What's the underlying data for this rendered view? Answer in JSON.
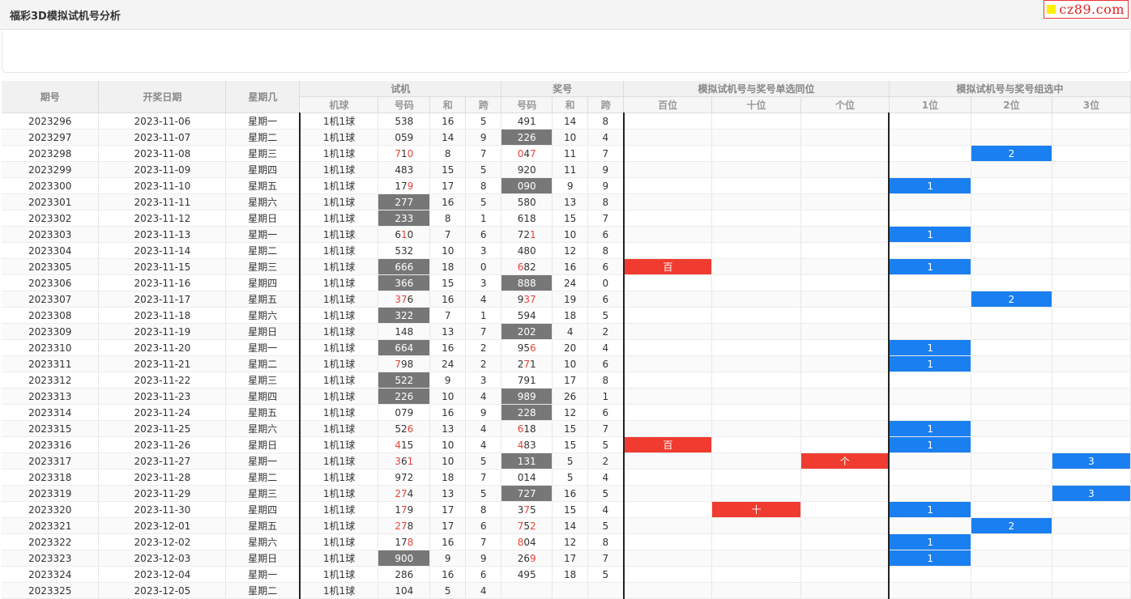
{
  "page": {
    "title": "福彩3D模拟试机号分析"
  },
  "logo": {
    "text": "cz89.com"
  },
  "table": {
    "header_row1": [
      "期号",
      "开奖日期",
      "星期几",
      "试机",
      "奖号",
      "模拟试机号与奖号单选同位",
      "模拟试机号与奖号组选中"
    ],
    "header_row2": [
      "机球",
      "号码",
      "和",
      "跨",
      "号码",
      "和",
      "跨",
      "百位",
      "十位",
      "个位",
      "1位",
      "2位",
      "3位"
    ],
    "rows": [
      {
        "issue": "2023296",
        "date": "2023-11-06",
        "weekday": "星期一",
        "machine": "1机1球",
        "trial": "538",
        "trial_sum": "16",
        "trial_span": "5",
        "draw": "491",
        "draw_sum": "14",
        "draw_span": "8",
        "same": [
          "",
          "",
          ""
        ],
        "group": [
          "",
          "",
          ""
        ]
      },
      {
        "issue": "2023297",
        "date": "2023-11-07",
        "weekday": "星期二",
        "machine": "1机1球",
        "trial": "059",
        "trial_sum": "14",
        "trial_span": "9",
        "draw": "226",
        "draw_sum": "10",
        "draw_span": "4",
        "same": [
          "",
          "",
          ""
        ],
        "group": [
          "",
          "",
          ""
        ]
      },
      {
        "issue": "2023298",
        "date": "2023-11-08",
        "weekday": "星期三",
        "machine": "1机1球",
        "trial": "710",
        "trial_sum": "8",
        "trial_span": "7",
        "draw": "047",
        "draw_sum": "11",
        "draw_span": "7",
        "same": [
          "",
          "",
          ""
        ],
        "group": [
          "",
          "2",
          ""
        ]
      },
      {
        "issue": "2023299",
        "date": "2023-11-09",
        "weekday": "星期四",
        "machine": "1机1球",
        "trial": "483",
        "trial_sum": "15",
        "trial_span": "5",
        "draw": "920",
        "draw_sum": "11",
        "draw_span": "9",
        "same": [
          "",
          "",
          ""
        ],
        "group": [
          "",
          "",
          ""
        ]
      },
      {
        "issue": "2023300",
        "date": "2023-11-10",
        "weekday": "星期五",
        "machine": "1机1球",
        "trial": "179",
        "trial_sum": "17",
        "trial_span": "8",
        "draw": "090",
        "draw_sum": "9",
        "draw_span": "9",
        "same": [
          "",
          "",
          ""
        ],
        "group": [
          "1",
          "",
          ""
        ]
      },
      {
        "issue": "2023301",
        "date": "2023-11-11",
        "weekday": "星期六",
        "machine": "1机1球",
        "trial": "277",
        "trial_sum": "16",
        "trial_span": "5",
        "draw": "580",
        "draw_sum": "13",
        "draw_span": "8",
        "same": [
          "",
          "",
          ""
        ],
        "group": [
          "",
          "",
          ""
        ]
      },
      {
        "issue": "2023302",
        "date": "2023-11-12",
        "weekday": "星期日",
        "machine": "1机1球",
        "trial": "233",
        "trial_sum": "8",
        "trial_span": "1",
        "draw": "618",
        "draw_sum": "15",
        "draw_span": "7",
        "same": [
          "",
          "",
          ""
        ],
        "group": [
          "",
          "",
          ""
        ]
      },
      {
        "issue": "2023303",
        "date": "2023-11-13",
        "weekday": "星期一",
        "machine": "1机1球",
        "trial": "610",
        "trial_sum": "7",
        "trial_span": "6",
        "draw": "721",
        "draw_sum": "10",
        "draw_span": "6",
        "same": [
          "",
          "",
          ""
        ],
        "group": [
          "1",
          "",
          ""
        ]
      },
      {
        "issue": "2023304",
        "date": "2023-11-14",
        "weekday": "星期二",
        "machine": "1机1球",
        "trial": "532",
        "trial_sum": "10",
        "trial_span": "3",
        "draw": "480",
        "draw_sum": "12",
        "draw_span": "8",
        "same": [
          "",
          "",
          ""
        ],
        "group": [
          "",
          "",
          ""
        ]
      },
      {
        "issue": "2023305",
        "date": "2023-11-15",
        "weekday": "星期三",
        "machine": "1机1球",
        "trial": "666",
        "trial_sum": "18",
        "trial_span": "0",
        "draw": "682",
        "draw_sum": "16",
        "draw_span": "6",
        "same": [
          "百",
          "",
          ""
        ],
        "group": [
          "1",
          "",
          ""
        ]
      },
      {
        "issue": "2023306",
        "date": "2023-11-16",
        "weekday": "星期四",
        "machine": "1机1球",
        "trial": "366",
        "trial_sum": "15",
        "trial_span": "3",
        "draw": "888",
        "draw_sum": "24",
        "draw_span": "0",
        "same": [
          "",
          "",
          ""
        ],
        "group": [
          "",
          "",
          ""
        ]
      },
      {
        "issue": "2023307",
        "date": "2023-11-17",
        "weekday": "星期五",
        "machine": "1机1球",
        "trial": "376",
        "trial_sum": "16",
        "trial_span": "4",
        "draw": "937",
        "draw_sum": "19",
        "draw_span": "6",
        "same": [
          "",
          "",
          ""
        ],
        "group": [
          "",
          "2",
          ""
        ]
      },
      {
        "issue": "2023308",
        "date": "2023-11-18",
        "weekday": "星期六",
        "machine": "1机1球",
        "trial": "322",
        "trial_sum": "7",
        "trial_span": "1",
        "draw": "594",
        "draw_sum": "18",
        "draw_span": "5",
        "same": [
          "",
          "",
          ""
        ],
        "group": [
          "",
          "",
          ""
        ]
      },
      {
        "issue": "2023309",
        "date": "2023-11-19",
        "weekday": "星期日",
        "machine": "1机1球",
        "trial": "148",
        "trial_sum": "13",
        "trial_span": "7",
        "draw": "202",
        "draw_sum": "4",
        "draw_span": "2",
        "same": [
          "",
          "",
          ""
        ],
        "group": [
          "",
          "",
          ""
        ]
      },
      {
        "issue": "2023310",
        "date": "2023-11-20",
        "weekday": "星期一",
        "machine": "1机1球",
        "trial": "664",
        "trial_sum": "16",
        "trial_span": "2",
        "draw": "956",
        "draw_sum": "20",
        "draw_span": "4",
        "same": [
          "",
          "",
          ""
        ],
        "group": [
          "1",
          "",
          ""
        ]
      },
      {
        "issue": "2023311",
        "date": "2023-11-21",
        "weekday": "星期二",
        "machine": "1机1球",
        "trial": "798",
        "trial_sum": "24",
        "trial_span": "2",
        "draw": "271",
        "draw_sum": "10",
        "draw_span": "6",
        "same": [
          "",
          "",
          ""
        ],
        "group": [
          "1",
          "",
          ""
        ]
      },
      {
        "issue": "2023312",
        "date": "2023-11-22",
        "weekday": "星期三",
        "machine": "1机1球",
        "trial": "522",
        "trial_sum": "9",
        "trial_span": "3",
        "draw": "791",
        "draw_sum": "17",
        "draw_span": "8",
        "same": [
          "",
          "",
          ""
        ],
        "group": [
          "",
          "",
          ""
        ]
      },
      {
        "issue": "2023313",
        "date": "2023-11-23",
        "weekday": "星期四",
        "machine": "1机1球",
        "trial": "226",
        "trial_sum": "10",
        "trial_span": "4",
        "draw": "989",
        "draw_sum": "26",
        "draw_span": "1",
        "same": [
          "",
          "",
          ""
        ],
        "group": [
          "",
          "",
          ""
        ]
      },
      {
        "issue": "2023314",
        "date": "2023-11-24",
        "weekday": "星期五",
        "machine": "1机1球",
        "trial": "079",
        "trial_sum": "16",
        "trial_span": "9",
        "draw": "228",
        "draw_sum": "12",
        "draw_span": "6",
        "same": [
          "",
          "",
          ""
        ],
        "group": [
          "",
          "",
          ""
        ]
      },
      {
        "issue": "2023315",
        "date": "2023-11-25",
        "weekday": "星期六",
        "machine": "1机1球",
        "trial": "526",
        "trial_sum": "13",
        "trial_span": "4",
        "draw": "618",
        "draw_sum": "15",
        "draw_span": "7",
        "same": [
          "",
          "",
          ""
        ],
        "group": [
          "1",
          "",
          ""
        ]
      },
      {
        "issue": "2023316",
        "date": "2023-11-26",
        "weekday": "星期日",
        "machine": "1机1球",
        "trial": "415",
        "trial_sum": "10",
        "trial_span": "4",
        "draw": "483",
        "draw_sum": "15",
        "draw_span": "5",
        "same": [
          "百",
          "",
          ""
        ],
        "group": [
          "1",
          "",
          ""
        ]
      },
      {
        "issue": "2023317",
        "date": "2023-11-27",
        "weekday": "星期一",
        "machine": "1机1球",
        "trial": "361",
        "trial_sum": "10",
        "trial_span": "5",
        "draw": "131",
        "draw_sum": "5",
        "draw_span": "2",
        "same": [
          "",
          "",
          "个"
        ],
        "group": [
          "",
          "",
          "3"
        ]
      },
      {
        "issue": "2023318",
        "date": "2023-11-28",
        "weekday": "星期二",
        "machine": "1机1球",
        "trial": "972",
        "trial_sum": "18",
        "trial_span": "7",
        "draw": "014",
        "draw_sum": "5",
        "draw_span": "4",
        "same": [
          "",
          "",
          ""
        ],
        "group": [
          "",
          "",
          ""
        ]
      },
      {
        "issue": "2023319",
        "date": "2023-11-29",
        "weekday": "星期三",
        "machine": "1机1球",
        "trial": "274",
        "trial_sum": "13",
        "trial_span": "5",
        "draw": "727",
        "draw_sum": "16",
        "draw_span": "5",
        "same": [
          "",
          "",
          ""
        ],
        "group": [
          "",
          "",
          "3"
        ]
      },
      {
        "issue": "2023320",
        "date": "2023-11-30",
        "weekday": "星期四",
        "machine": "1机1球",
        "trial": "179",
        "trial_sum": "17",
        "trial_span": "8",
        "draw": "375",
        "draw_sum": "15",
        "draw_span": "4",
        "same": [
          "",
          "十",
          ""
        ],
        "group": [
          "1",
          "",
          ""
        ]
      },
      {
        "issue": "2023321",
        "date": "2023-12-01",
        "weekday": "星期五",
        "machine": "1机1球",
        "trial": "278",
        "trial_sum": "17",
        "trial_span": "6",
        "draw": "752",
        "draw_sum": "14",
        "draw_span": "5",
        "same": [
          "",
          "",
          ""
        ],
        "group": [
          "",
          "2",
          ""
        ]
      },
      {
        "issue": "2023322",
        "date": "2023-12-02",
        "weekday": "星期六",
        "machine": "1机1球",
        "trial": "178",
        "trial_sum": "16",
        "trial_span": "7",
        "draw": "804",
        "draw_sum": "12",
        "draw_span": "8",
        "same": [
          "",
          "",
          ""
        ],
        "group": [
          "1",
          "",
          ""
        ]
      },
      {
        "issue": "2023323",
        "date": "2023-12-03",
        "weekday": "星期日",
        "machine": "1机1球",
        "trial": "900",
        "trial_sum": "9",
        "trial_span": "9",
        "draw": "269",
        "draw_sum": "17",
        "draw_span": "7",
        "same": [
          "",
          "",
          ""
        ],
        "group": [
          "1",
          "",
          ""
        ]
      },
      {
        "issue": "2023324",
        "date": "2023-12-04",
        "weekday": "星期一",
        "machine": "1机1球",
        "trial": "286",
        "trial_sum": "16",
        "trial_span": "6",
        "draw": "495",
        "draw_sum": "18",
        "draw_span": "5",
        "same": [
          "",
          "",
          ""
        ],
        "group": [
          "",
          "",
          ""
        ]
      },
      {
        "issue": "2023325",
        "date": "2023-12-05",
        "weekday": "星期二",
        "machine": "1机1球",
        "trial": "104",
        "trial_sum": "5",
        "trial_span": "4",
        "draw": "",
        "draw_sum": "",
        "draw_span": "",
        "same": [
          "",
          "",
          ""
        ],
        "group": [
          "",
          "",
          ""
        ]
      }
    ]
  },
  "colors": {
    "highlight_gray": "#777777",
    "digit_red": "#e8423a",
    "mark_red": "#f03c30",
    "mark_blue": "#1a7ff0"
  }
}
